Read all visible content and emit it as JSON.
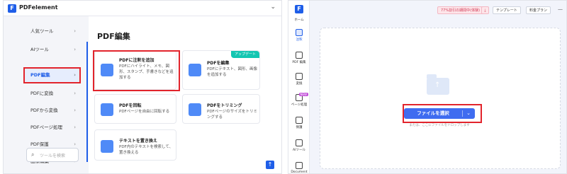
{
  "left_window": {
    "app_name": "PDFelement",
    "logo_letter": "F",
    "collapse_icon": "chevron-down-icon",
    "sidebar": {
      "items": [
        {
          "label": "人気ツール"
        },
        {
          "label": "AIツール"
        },
        {
          "label": "PDF編集",
          "active": true
        },
        {
          "label": "PDFに変換"
        },
        {
          "label": "PDFから変換"
        },
        {
          "label": "PDFページ処理"
        },
        {
          "label": "PDF保護"
        },
        {
          "label": "画像編集"
        }
      ],
      "search_placeholder": "ツールを検索"
    },
    "main": {
      "title": "PDF編集",
      "cards": [
        {
          "title": "PDFに注釈を追加",
          "desc": "PDFにハイライト、メモ、図形、スタンプ、手書きなどを追加する",
          "icon": "annotate-icon",
          "highlighted": true
        },
        {
          "title": "PDFを編集",
          "desc": "PDFにテキスト、図形、画像を追加する",
          "icon": "edit-doc-icon",
          "badge": "アップデート"
        },
        {
          "title": "PDFを回転",
          "desc": "PDFページを自由に回転する",
          "icon": "rotate-icon"
        },
        {
          "title": "PDFをトリミング",
          "desc": "PDFページのサイズをトリミングする",
          "icon": "crop-icon"
        },
        {
          "title": "テキストを置き換え",
          "desc": "PDF内のテキストを検索して、置き換える",
          "icon": "replace-text-icon"
        }
      ]
    }
  },
  "right_window": {
    "logo_letter": "F",
    "rail": [
      {
        "label": "ホーム",
        "icon": "home-icon"
      },
      {
        "label": "注釈",
        "icon": "annotate-icon",
        "active": true
      },
      {
        "label": "PDF 編集",
        "icon": "edit-icon"
      },
      {
        "label": "変換",
        "icon": "convert-icon"
      },
      {
        "label": "ページ処理",
        "icon": "pages-icon",
        "badge": "NEW"
      },
      {
        "label": "保護",
        "icon": "shield-icon"
      },
      {
        "label": "AIツール",
        "icon": "ai-robot-icon"
      },
      {
        "label": "Document",
        "icon": "document-icon"
      }
    ],
    "topbar": {
      "promo": "77%割引の期間中(体験)",
      "download_icon": "download-icon",
      "template_label": "テンプレート",
      "pricing_label": "料金プラン"
    },
    "dropzone": {
      "button_label": "ファイルを選択",
      "hint": "または、ここにファイルをドロップします"
    }
  },
  "colors": {
    "accent": "#1f5ee8",
    "highlight_red": "#e2242c",
    "badge_teal": "#13c6b1",
    "button_blue": "#3f6cf0"
  }
}
